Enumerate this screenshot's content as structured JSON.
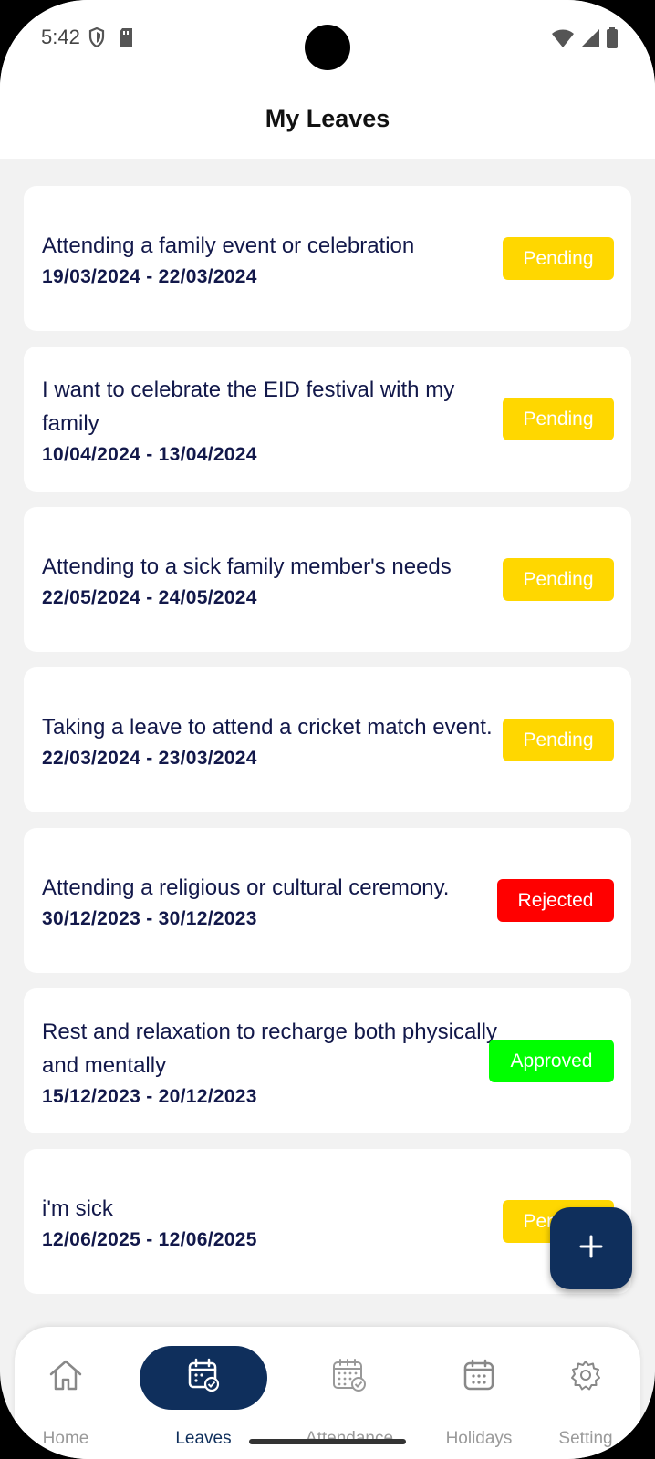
{
  "status_bar": {
    "time": "5:42"
  },
  "app_bar": {
    "title": "My Leaves"
  },
  "leaves": [
    {
      "reason": "Attending a family event or celebration",
      "dates": "19/03/2024 - 22/03/2024",
      "status": "Pending"
    },
    {
      "reason": "I want to celebrate the EID festival with my family",
      "dates": "10/04/2024 - 13/04/2024",
      "status": "Pending"
    },
    {
      "reason": "Attending to a sick family member's needs",
      "dates": "22/05/2024 - 24/05/2024",
      "status": "Pending"
    },
    {
      "reason": "Taking a leave to attend a cricket match event.",
      "dates": "22/03/2024 - 23/03/2024",
      "status": "Pending"
    },
    {
      "reason": "Attending a religious or cultural ceremony.",
      "dates": "30/12/2023 - 30/12/2023",
      "status": "Rejected"
    },
    {
      "reason": "Rest and relaxation to recharge both physically and mentally",
      "dates": "15/12/2023 - 20/12/2023",
      "status": "Approved"
    },
    {
      "reason": "i'm sick",
      "dates": "12/06/2025 - 12/06/2025",
      "status": "Pending"
    }
  ],
  "status_colors": {
    "Pending": "#ffd700",
    "Rejected": "#ff0000",
    "Approved": "#00ff00"
  },
  "fab": {
    "icon": "plus-icon"
  },
  "bottom_nav": {
    "items": [
      {
        "label": "Home",
        "icon": "home-icon",
        "active": false
      },
      {
        "label": "Leaves",
        "icon": "calendar-check-icon",
        "active": true
      },
      {
        "label": "Attendance",
        "icon": "attendance-calendar-icon",
        "active": false
      },
      {
        "label": "Holidays",
        "icon": "calendar-icon",
        "active": false
      },
      {
        "label": "Setting",
        "icon": "gear-icon",
        "active": false
      }
    ]
  },
  "colors": {
    "primary": "#0f2f5c",
    "text": "#12184a",
    "background": "#f2f2f2"
  }
}
